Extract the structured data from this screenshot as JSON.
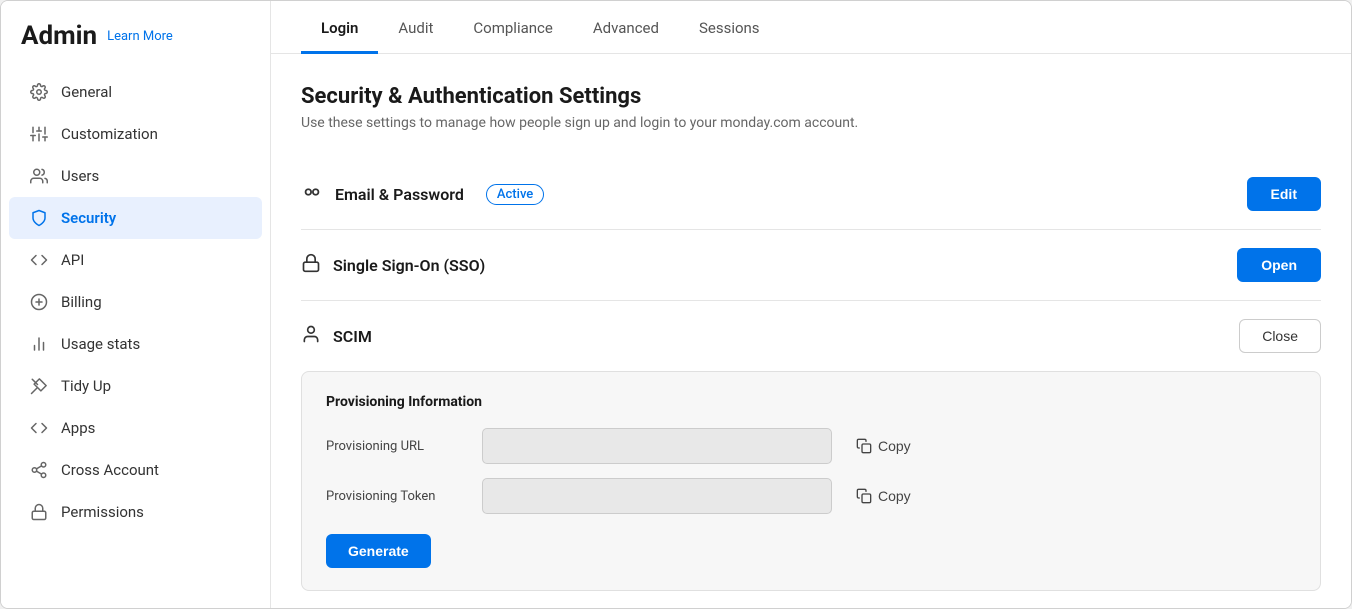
{
  "sidebar": {
    "title": "Admin",
    "learn_more": "Learn More",
    "items": [
      {
        "id": "general",
        "label": "General",
        "icon": "gear"
      },
      {
        "id": "customization",
        "label": "Customization",
        "icon": "sliders"
      },
      {
        "id": "users",
        "label": "Users",
        "icon": "users"
      },
      {
        "id": "security",
        "label": "Security",
        "icon": "shield",
        "active": true
      },
      {
        "id": "api",
        "label": "API",
        "icon": "api"
      },
      {
        "id": "billing",
        "label": "Billing",
        "icon": "dollar"
      },
      {
        "id": "usage-stats",
        "label": "Usage stats",
        "icon": "bar-chart"
      },
      {
        "id": "tidy-up",
        "label": "Tidy Up",
        "icon": "broom"
      },
      {
        "id": "apps",
        "label": "Apps",
        "icon": "code"
      },
      {
        "id": "cross-account",
        "label": "Cross Account",
        "icon": "share"
      },
      {
        "id": "permissions",
        "label": "Permissions",
        "icon": "lock"
      }
    ]
  },
  "tabs": [
    {
      "id": "login",
      "label": "Login",
      "active": true
    },
    {
      "id": "audit",
      "label": "Audit"
    },
    {
      "id": "compliance",
      "label": "Compliance"
    },
    {
      "id": "advanced",
      "label": "Advanced"
    },
    {
      "id": "sessions",
      "label": "Sessions"
    }
  ],
  "page": {
    "title": "Security & Authentication Settings",
    "subtitle": "Use these settings to manage how people sign up and login to your monday.com account."
  },
  "sections": {
    "email_password": {
      "name": "Email & Password",
      "badge": "Active",
      "button": "Edit"
    },
    "sso": {
      "name": "Single Sign-On (SSO)",
      "button": "Open"
    },
    "scim": {
      "name": "SCIM",
      "button": "Close",
      "panel_title": "Provisioning Information",
      "url_label": "Provisioning URL",
      "url_placeholder": "",
      "url_copy": "Copy",
      "token_label": "Provisioning Token",
      "token_placeholder": "",
      "token_copy": "Copy",
      "generate_label": "Generate"
    }
  }
}
